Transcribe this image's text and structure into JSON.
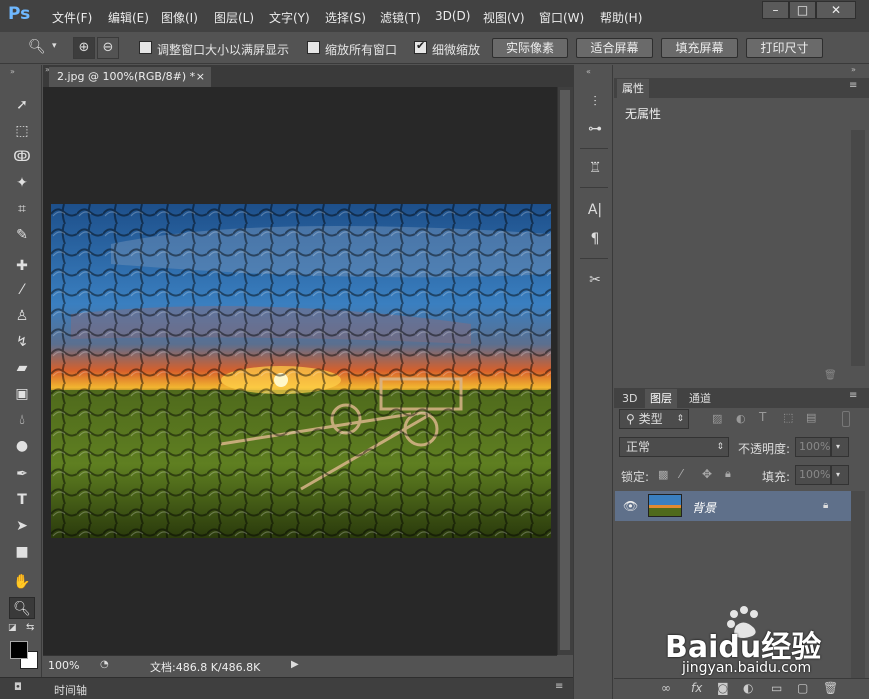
{
  "app": {
    "logo": "Ps",
    "menu": [
      "文件(F)",
      "编辑(E)",
      "图像(I)",
      "图层(L)",
      "文字(Y)",
      "选择(S)",
      "滤镜(T)",
      "3D(D)",
      "视图(V)",
      "窗口(W)",
      "帮助(H)"
    ],
    "window_controls": [
      "–",
      "□",
      "✕"
    ]
  },
  "options_bar": {
    "tool_icon": "zoom-icon",
    "resize_windows_label": "调整窗口大小以满屏显示",
    "resize_windows_checked": false,
    "zoom_all_label": "缩放所有窗口",
    "zoom_all_checked": false,
    "scrubby_zoom_label": "细微缩放",
    "scrubby_zoom_checked": true,
    "buttons": [
      "实际像素",
      "适合屏幕",
      "填充屏幕",
      "打印尺寸"
    ]
  },
  "document": {
    "tab_title": "2.jpg @ 100%(RGB/8#) *",
    "close_glyph": "×",
    "zoom": "100%",
    "doc_info": "文档:486.8 K/486.8K",
    "timeline_label": "时间轴"
  },
  "properties_panel": {
    "tab": "属性",
    "content": "无属性"
  },
  "layers_panel": {
    "tabs": [
      "3D",
      "图层",
      "通道"
    ],
    "active_tab": "图层",
    "filter_label": "类型",
    "blend_mode": "正常",
    "opacity_label": "不透明度:",
    "opacity_value": "100%",
    "lock_label": "锁定:",
    "fill_label": "填充:",
    "fill_value": "100%",
    "layer_name": "背景"
  },
  "watermark": {
    "brand_text": "Baidu经验",
    "url": "jingyan.baidu.com"
  },
  "colors": {
    "ui_bg": "#535353",
    "canvas_bg": "#282828",
    "selected_layer": "#5f708a",
    "logo_blue": "#6fb8ff"
  }
}
